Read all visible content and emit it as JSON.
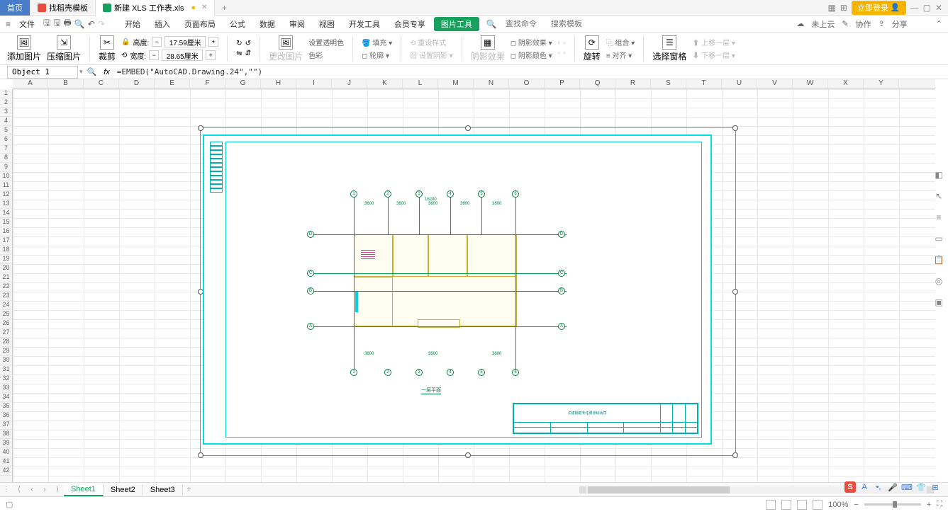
{
  "tabs": {
    "home": "首页",
    "template": "找稻壳模板",
    "file": "新建 XLS 工作表.xls"
  },
  "login": "立即登录",
  "menu": {
    "file": "文件",
    "start": "开始",
    "insert": "插入",
    "page": "页面布局",
    "formula": "公式",
    "data": "数据",
    "review": "审阅",
    "view": "视图",
    "devtools": "开发工具",
    "member": "会员专享",
    "pictools": "图片工具",
    "search_ph": "查找命令...",
    "search_tpl": "搜索模板"
  },
  "menuright": {
    "cloud": "未上云",
    "coop": "协作",
    "share": "分享"
  },
  "ribbon": {
    "add_image": "添加图片",
    "compress": "压缩图片",
    "crop": "裁剪",
    "height_lbl": "高度:",
    "height_val": "17.59厘米",
    "width_lbl": "宽度:",
    "width_val": "28.65厘米",
    "change_img": "更改图片",
    "transparency": "设置透明色",
    "color": "色彩",
    "fill": "填充",
    "outline": "轮廓",
    "effects": "阴影效果",
    "shadow_color": "阴影颜色",
    "reset": "重设样式",
    "set_shadow": "设置阴影",
    "rotate": "旋转",
    "combine": "组合",
    "align": "对齐",
    "sel_pane": "选择窗格",
    "layer_up": "上移一层",
    "layer_down": "下移一层"
  },
  "namebox": "Object 1",
  "formula": "=EMBED(\"AutoCAD.Drawing.24\",\"\")",
  "cols": [
    "A",
    "B",
    "C",
    "D",
    "E",
    "F",
    "G",
    "H",
    "I",
    "J",
    "K",
    "L",
    "M",
    "N",
    "O",
    "P",
    "Q",
    "R",
    "S",
    "T",
    "U",
    "V",
    "W",
    "X",
    "Y"
  ],
  "sheets": {
    "s1": "Sheet1",
    "s2": "Sheet2",
    "s3": "Sheet3"
  },
  "zoom": "100%",
  "drawing": {
    "title": "一层平面",
    "company": "江建钢筋专任限测绘会司",
    "grids_h": [
      "1",
      "2",
      "3",
      "4",
      "5",
      "6"
    ],
    "grids_v": [
      "A",
      "B",
      "C",
      "D"
    ]
  }
}
